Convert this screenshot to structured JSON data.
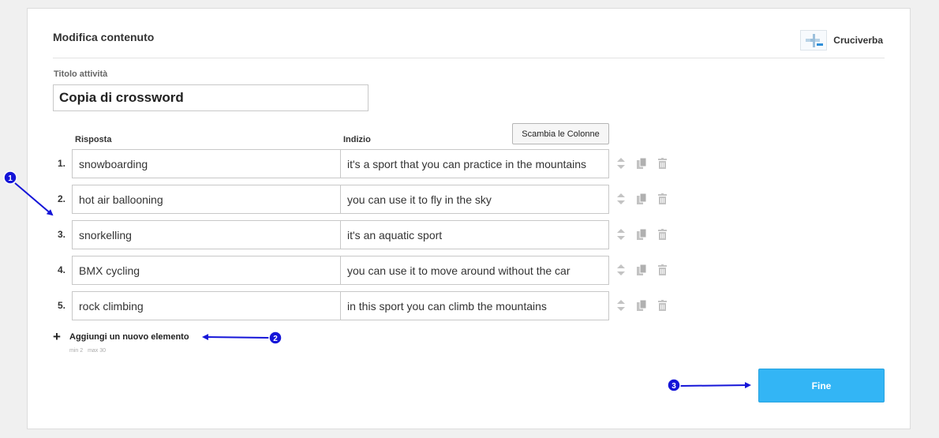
{
  "header": {
    "title": "Modifica contenuto",
    "activity_type_label": "Cruciverba",
    "activity_type_icon": "crossword-icon"
  },
  "activity_title": {
    "label": "Titolo attività",
    "value": "Copia di crossword"
  },
  "columns": {
    "answer_header": "Risposta",
    "clue_header": "Indizio",
    "swap_button_label": "Scambia le Colonne"
  },
  "rows": [
    {
      "number": "1.",
      "answer": "snowboarding",
      "clue": "it's a sport that you can practice in the mountains"
    },
    {
      "number": "2.",
      "answer": "hot air ballooning",
      "clue": "you can use it to fly in the sky"
    },
    {
      "number": "3.",
      "answer": "snorkelling",
      "clue": "it's an aquatic sport"
    },
    {
      "number": "4.",
      "answer": "BMX cycling",
      "clue": "you can use it to move around without the car"
    },
    {
      "number": "5.",
      "answer": "rock climbing",
      "clue": "in this sport you can climb the mountains"
    }
  ],
  "row_actions": [
    "reorder-icon",
    "duplicate-icon",
    "trash-icon"
  ],
  "add_item": {
    "icon": "plus-icon",
    "label": "Aggiungi un nuovo elemento",
    "min_hint": "min 2",
    "max_hint": "max 30"
  },
  "done_button_label": "Fine",
  "annotations": [
    {
      "badge": "1"
    },
    {
      "badge": "2"
    },
    {
      "badge": "3"
    }
  ],
  "colors": {
    "accent": "#33b5f5",
    "annotation": "#1515d8",
    "background": "#f0f0f0"
  }
}
